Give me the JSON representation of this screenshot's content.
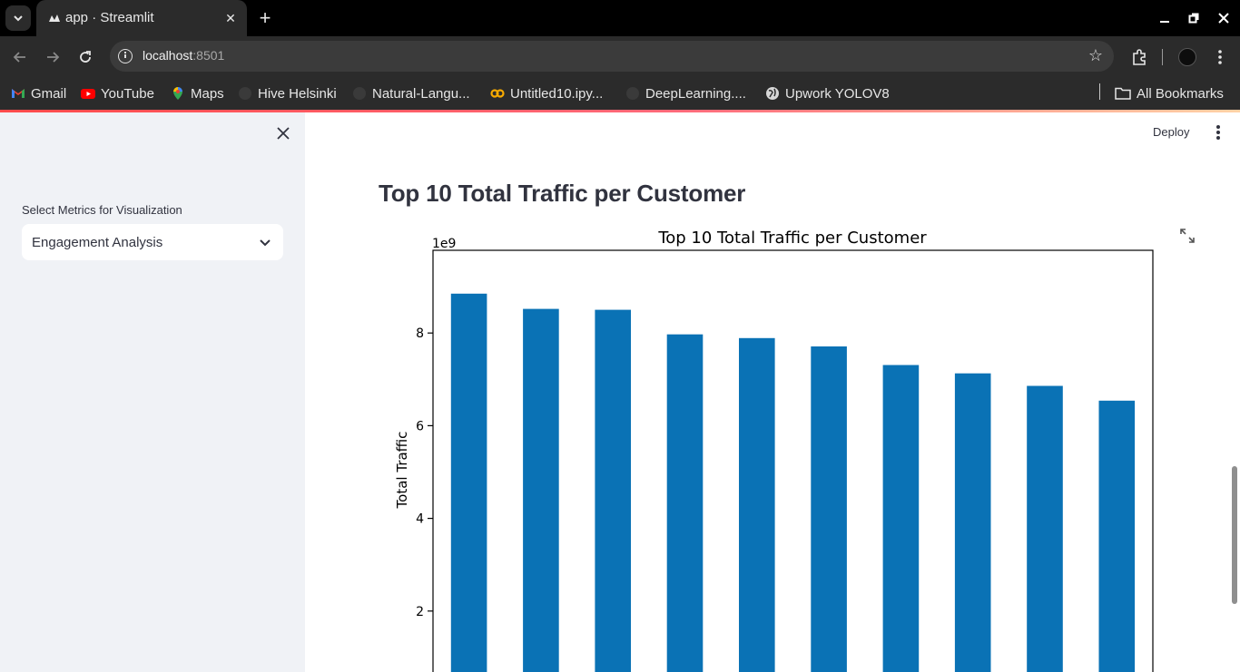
{
  "browser": {
    "tab_title": "app · Streamlit",
    "url_host": "localhost",
    "url_port": ":8501",
    "bookmarks": [
      {
        "label": "Gmail",
        "icon": "gmail-icon"
      },
      {
        "label": "YouTube",
        "icon": "youtube-icon"
      },
      {
        "label": "Maps",
        "icon": "maps-icon"
      },
      {
        "label": "Hive Helsinki",
        "icon": "github-icon"
      },
      {
        "label": "Natural-Langu...",
        "icon": "github-icon"
      },
      {
        "label": "Untitled10.ipy...",
        "icon": "colab-icon"
      },
      {
        "label": "DeepLearning....",
        "icon": "github-icon"
      },
      {
        "label": "Upwork YOLOV8",
        "icon": "globe-icon"
      }
    ],
    "all_bookmarks_label": "All Bookmarks"
  },
  "sidebar": {
    "select_label": "Select Metrics for Visualization",
    "select_value": "Engagement Analysis"
  },
  "header": {
    "deploy_label": "Deploy"
  },
  "main": {
    "heading": "Top 10 Total Traffic per Customer"
  },
  "colors": {
    "bar": "#0a72b5",
    "streamlit_accent": "#ff4b4b",
    "sidebar_bg": "#f0f2f6"
  },
  "chart_data": {
    "type": "bar",
    "title": "Top 10 Total Traffic per Customer",
    "ylabel": "Total Traffic",
    "xlabel": "",
    "scale_label": "1e9",
    "yticks": [
      2,
      4,
      6,
      8
    ],
    "ylim": [
      0,
      9.3
    ],
    "categories": [
      "",
      "",
      "",
      "",
      "",
      "",
      "",
      "",
      "",
      ""
    ],
    "values": [
      8.85,
      8.52,
      8.5,
      7.97,
      7.89,
      7.71,
      7.31,
      7.13,
      6.86,
      6.54
    ],
    "legend": "none",
    "grid": false
  }
}
